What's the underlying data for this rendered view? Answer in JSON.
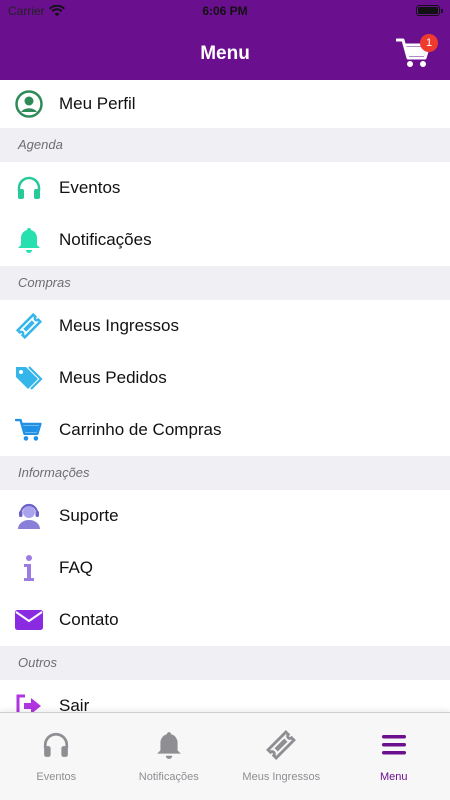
{
  "status_bar": {
    "carrier": "Carrier",
    "time": "6:06 PM"
  },
  "navbar": {
    "title": "Menu",
    "cart_badge": "1",
    "cart_icon": "cart-icon"
  },
  "menu": {
    "profile": {
      "label": "Meu Perfil",
      "icon": "user-circle-icon",
      "color": "#2e8b57"
    },
    "sections": [
      {
        "title": "Agenda",
        "items": [
          {
            "label": "Eventos",
            "icon": "headphones-icon",
            "color": "#27c99a"
          },
          {
            "label": "Notificações",
            "icon": "bell-icon",
            "color": "#27e0b0"
          }
        ]
      },
      {
        "title": "Compras",
        "items": [
          {
            "label": "Meus Ingressos",
            "icon": "ticket-icon",
            "color": "#35b6ea"
          },
          {
            "label": "Meus Pedidos",
            "icon": "tags-icon",
            "color": "#35b6ea"
          },
          {
            "label": "Carrinho de Compras",
            "icon": "cart-icon",
            "color": "#1e90e6"
          }
        ]
      },
      {
        "title": "Informações",
        "items": [
          {
            "label": "Suporte",
            "icon": "support-agent-icon",
            "color": "#8a7fd8"
          },
          {
            "label": "FAQ",
            "icon": "info-icon",
            "color": "#9d7be5"
          },
          {
            "label": "Contato",
            "icon": "envelope-icon",
            "color": "#8a2be2"
          }
        ]
      },
      {
        "title": "Outros",
        "items": [
          {
            "label": "Sair",
            "icon": "sign-out-icon",
            "color": "#b035e0"
          }
        ]
      }
    ]
  },
  "tabbar": [
    {
      "label": "Eventos",
      "icon": "headphones-icon"
    },
    {
      "label": "Notificações",
      "icon": "bell-icon"
    },
    {
      "label": "Meus Ingressos",
      "icon": "ticket-icon"
    },
    {
      "label": "Menu",
      "icon": "hamburger-icon",
      "active": true
    }
  ],
  "colors": {
    "primary": "#6a0f8e",
    "inactive_tab": "#8e8e93",
    "badge": "#ef3b2d"
  }
}
